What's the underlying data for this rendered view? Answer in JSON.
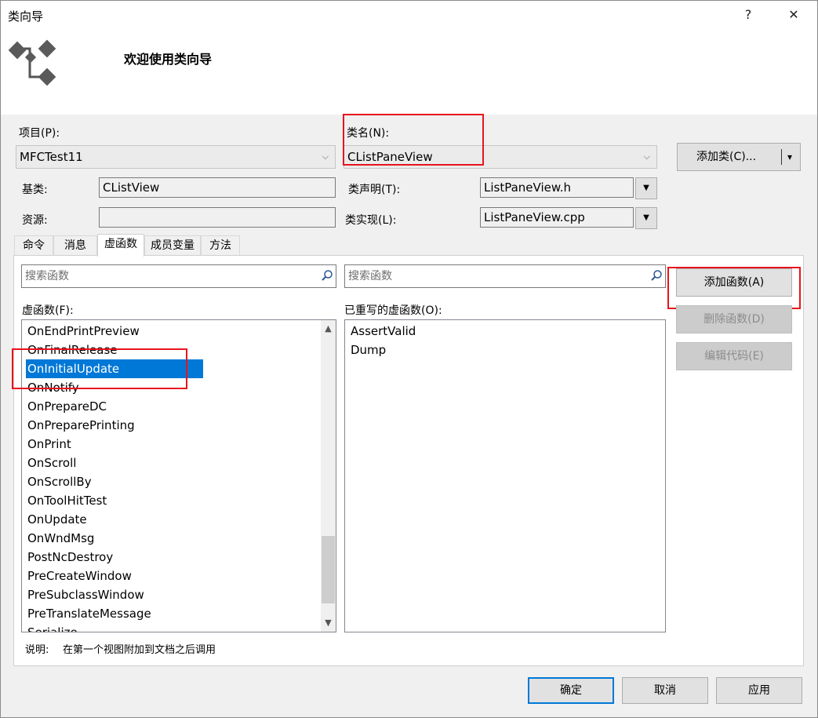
{
  "window": {
    "title": "类向导",
    "help_label": "?",
    "close_label": "✕"
  },
  "header": {
    "welcome": "欢迎使用类向导"
  },
  "project": {
    "label": "项目(P):",
    "value": "MFCTest11"
  },
  "classname": {
    "label": "类名(N):",
    "value": "CListPaneView"
  },
  "add_class_button": {
    "label": "添加类(C)...",
    "arrow": "▾"
  },
  "base_class": {
    "label": "基类:",
    "value": "CListView"
  },
  "resource": {
    "label": "资源:",
    "value": ""
  },
  "declaration": {
    "label": "类声明(T):",
    "value": "ListPaneView.h"
  },
  "implementation": {
    "label": "类实现(L):",
    "value": "ListPaneView.cpp"
  },
  "tabs": [
    {
      "label": "命令"
    },
    {
      "label": "消息"
    },
    {
      "label": "虚函数"
    },
    {
      "label": "成员变量"
    },
    {
      "label": "方法"
    }
  ],
  "left_search": {
    "placeholder": "搜索函数"
  },
  "right_search": {
    "placeholder": "搜索函数"
  },
  "virtual_functions": {
    "label": "虚函数(F):",
    "items": [
      "OnEndPrintPreview",
      "OnFinalRelease",
      "OnInitialUpdate",
      "OnNotify",
      "OnPrepareDC",
      "OnPreparePrinting",
      "OnPrint",
      "OnScroll",
      "OnScrollBy",
      "OnToolHitTest",
      "OnUpdate",
      "OnWndMsg",
      "PostNcDestroy",
      "PreCreateWindow",
      "PreSubclassWindow",
      "PreTranslateMessage",
      "Serialize"
    ],
    "selected": "OnInitialUpdate"
  },
  "overridden_functions": {
    "label": "已重写的虚函数(O):",
    "items": [
      "AssertValid",
      "Dump"
    ]
  },
  "side_buttons": {
    "add_function": "添加函数(A)",
    "delete_function": "删除函数(D)",
    "edit_code": "编辑代码(E)"
  },
  "description": {
    "label": "说明:",
    "text": "在第一个视图附加到文档之后调用"
  },
  "footer": {
    "ok": "确定",
    "cancel": "取消",
    "apply": "应用"
  },
  "colors": {
    "selection": "#0078d7",
    "highlight_box": "#e8141c",
    "dialog_bg": "#f0f0f0"
  }
}
